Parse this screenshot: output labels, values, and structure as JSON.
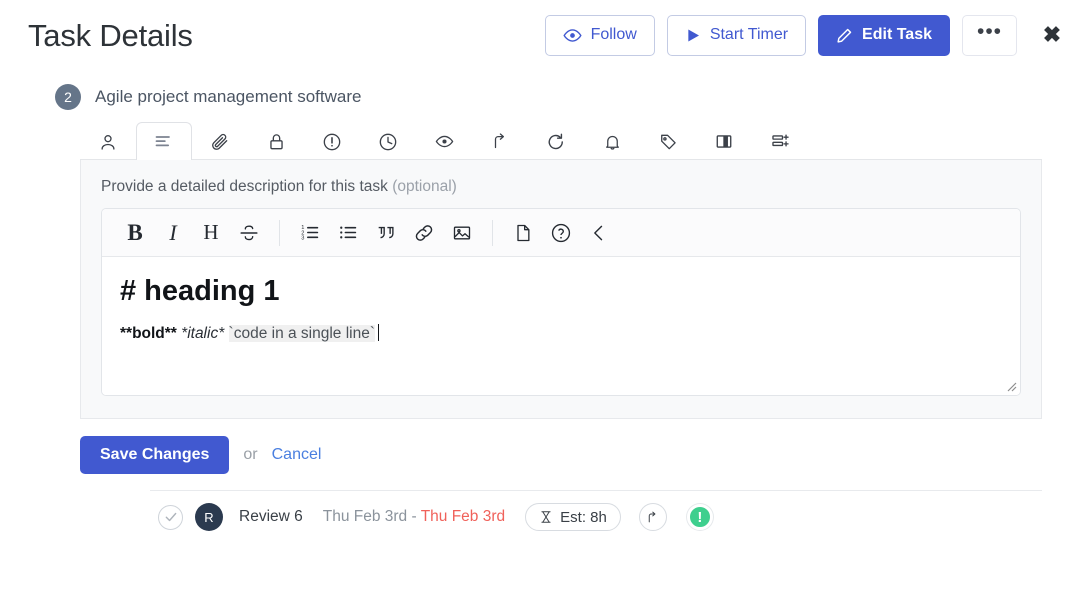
{
  "header": {
    "title": "Task Details",
    "actions": [
      {
        "id": "follow",
        "label": "Follow",
        "icon": "eye-icon"
      },
      {
        "id": "start-timer",
        "label": "Start Timer",
        "icon": "play-icon"
      },
      {
        "id": "edit-task",
        "label": "Edit Task",
        "icon": "pencil-icon"
      }
    ],
    "more_label": "•••",
    "close_label": "✖"
  },
  "task": {
    "badge": "2",
    "name": "Agile project management software"
  },
  "tabs": [
    {
      "id": "assignees",
      "icon": "user-icon",
      "active": false
    },
    {
      "id": "description",
      "icon": "align-left-icon",
      "active": true
    },
    {
      "id": "attachments",
      "icon": "paperclip-icon",
      "active": false
    },
    {
      "id": "permissions",
      "icon": "lock-icon",
      "active": false
    },
    {
      "id": "priority",
      "icon": "alert-circle-icon",
      "active": false
    },
    {
      "id": "time",
      "icon": "clock-icon",
      "active": false
    },
    {
      "id": "watchers",
      "icon": "eye-icon",
      "active": false
    },
    {
      "id": "share",
      "icon": "arrow-up-icon",
      "active": false
    },
    {
      "id": "repeat",
      "icon": "refresh-icon",
      "active": false
    },
    {
      "id": "reminders",
      "icon": "bell-icon",
      "active": false
    },
    {
      "id": "tags",
      "icon": "tag-icon",
      "active": false
    },
    {
      "id": "columns",
      "icon": "columns-icon",
      "active": false
    },
    {
      "id": "subtasks",
      "icon": "list-add-icon",
      "active": false
    }
  ],
  "description": {
    "label": "Provide a detailed description for this task",
    "optional": "(optional)",
    "toolbar": [
      {
        "id": "bold",
        "icon": "bold-icon",
        "glyph": "B"
      },
      {
        "id": "italic",
        "icon": "italic-icon",
        "glyph": "I"
      },
      {
        "id": "heading",
        "icon": "heading-icon",
        "glyph": "H"
      },
      {
        "id": "strikethrough",
        "icon": "strikethrough-icon",
        "glyph": "S"
      },
      {
        "id": "ordered-list",
        "icon": "ordered-list-icon",
        "glyph": ""
      },
      {
        "id": "bullet-list",
        "icon": "bullet-list-icon",
        "glyph": ""
      },
      {
        "id": "blockquote",
        "icon": "quote-icon",
        "glyph": ""
      },
      {
        "id": "link",
        "icon": "link-icon",
        "glyph": ""
      },
      {
        "id": "image",
        "icon": "image-icon",
        "glyph": ""
      },
      {
        "id": "document",
        "icon": "file-icon",
        "glyph": ""
      },
      {
        "id": "help",
        "icon": "help-circle-icon",
        "glyph": ""
      },
      {
        "id": "collapse",
        "icon": "chevron-left-icon",
        "glyph": ""
      }
    ],
    "content": {
      "heading_line": "# heading 1",
      "bold_token": "**bold**",
      "italic_token": "*italic*",
      "code_token": "`code in a single line`"
    }
  },
  "actions": {
    "save_label": "Save Changes",
    "or_label": "or",
    "cancel_label": "Cancel"
  },
  "subitem": {
    "avatar_initial": "R",
    "name": "Review 6",
    "date_start": "Thu Feb 3rd",
    "date_separator": "-",
    "date_end": "Thu Feb 3rd",
    "estimate": "Est: 8h",
    "estimate_icon": "hourglass-icon",
    "share_icon": "arrow-up-icon",
    "status_icon": "exclamation-icon"
  },
  "colors": {
    "primary": "#4159d0",
    "link": "#4a7fe0",
    "danger": "#f0615a",
    "success": "#3ecf8e",
    "badge": "#657589",
    "avatar": "#2b3a4f"
  }
}
